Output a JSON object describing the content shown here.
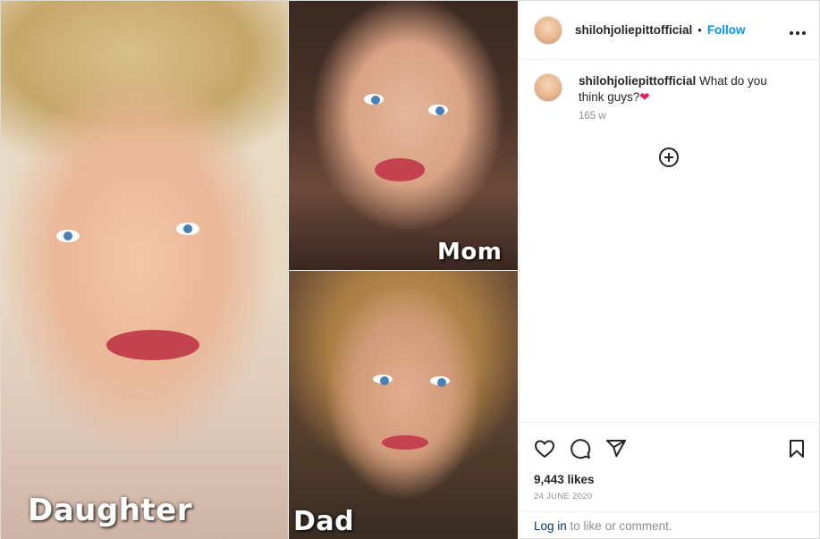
{
  "post": {
    "username": "shilohjoliepittofficial",
    "follow_label": "Follow",
    "separator": "•",
    "more_label": "•••"
  },
  "media": {
    "labels": {
      "daughter": "Daughter",
      "mom": "Mom",
      "dad": "Dad"
    }
  },
  "caption": {
    "username": "shilohjoliepittofficial",
    "text": "What do you think guys?",
    "emoji": "❤",
    "time": "165 w"
  },
  "engagement": {
    "likes": "9,443 likes",
    "date": "24 JUNE 2020"
  },
  "footer": {
    "login_link": "Log in",
    "login_rest": " to like or comment."
  },
  "colors": {
    "link_blue": "#0095f6",
    "muted": "#8e8e8e",
    "heart": "#e0245e"
  },
  "icons": [
    "more-icon",
    "load-more-comments-icon",
    "like-icon",
    "comment-icon",
    "share-icon",
    "save-icon"
  ]
}
